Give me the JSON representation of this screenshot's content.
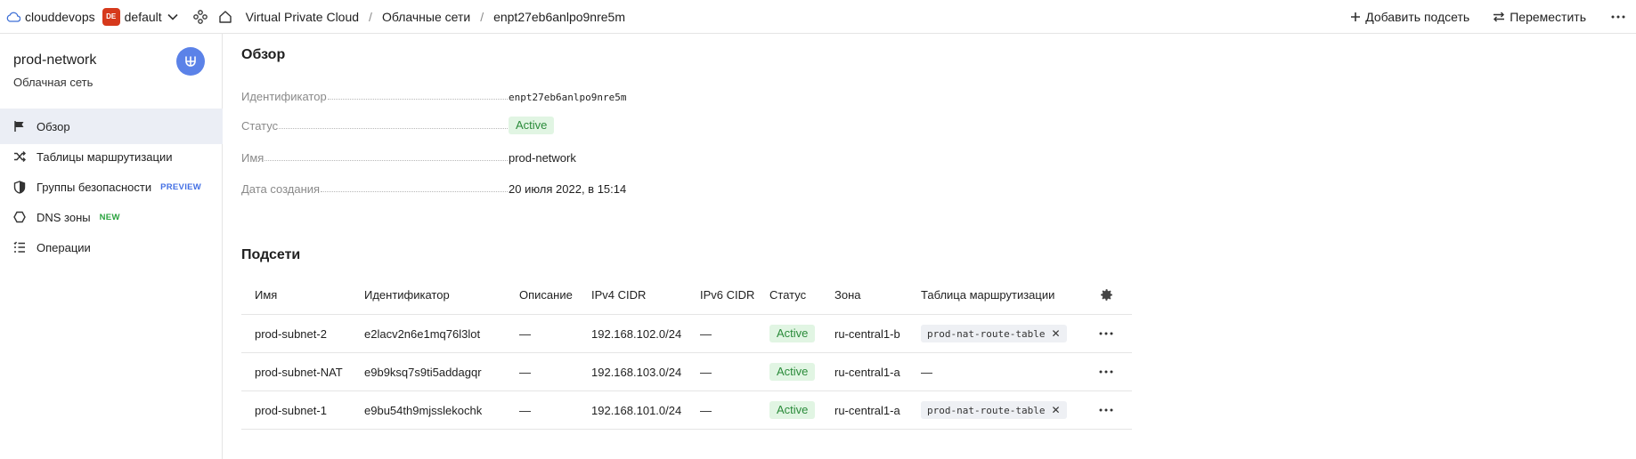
{
  "topbar": {
    "org": "clouddevops",
    "folder_badge": "DE",
    "folder": "default",
    "breadcrumbs": [
      "Virtual Private Cloud",
      "Облачные сети",
      "enpt27eb6anlpo9nre5m"
    ],
    "breadcrumb_separator": "/",
    "actions": {
      "add_subnet": "Добавить подсеть",
      "move": "Переместить"
    }
  },
  "sidebar": {
    "title": "prod-network",
    "subtitle": "Облачная сеть",
    "items": [
      {
        "label": "Обзор",
        "icon": "flag-icon",
        "active": true,
        "tag": ""
      },
      {
        "label": "Таблицы маршрутизации",
        "icon": "shuffle-icon",
        "active": false,
        "tag": ""
      },
      {
        "label": "Группы безопасности",
        "icon": "shield-icon",
        "active": false,
        "tag": "PREVIEW"
      },
      {
        "label": "DNS зоны",
        "icon": "hexagon-icon",
        "active": false,
        "tag": "NEW"
      },
      {
        "label": "Операции",
        "icon": "list-icon",
        "active": false,
        "tag": ""
      }
    ]
  },
  "overview": {
    "heading": "Обзор",
    "properties": [
      {
        "key": "Идентификатор",
        "value": "enpt27eb6anlpo9nre5m"
      },
      {
        "key": "Статус",
        "value": "Active"
      },
      {
        "key": "Имя",
        "value": "prod-network"
      },
      {
        "key": "Дата создания",
        "value": "20 июля 2022, в 15:14"
      }
    ]
  },
  "subnets": {
    "heading": "Подсети",
    "columns": [
      "Имя",
      "Идентификатор",
      "Описание",
      "IPv4 CIDR",
      "IPv6 CIDR",
      "Статус",
      "Зона",
      "Таблица маршрутизации"
    ],
    "rows": [
      {
        "name": "prod-subnet-2",
        "id": "e2lacv2n6e1mq76l3lot",
        "description": "—",
        "ipv4": "192.168.102.0/24",
        "ipv6": "—",
        "status": "Active",
        "zone": "ru-central1-b",
        "route_table": "prod-nat-route-table"
      },
      {
        "name": "prod-subnet-NAT",
        "id": "e9b9ksq7s9ti5addagqr",
        "description": "—",
        "ipv4": "192.168.103.0/24",
        "ipv6": "—",
        "status": "Active",
        "zone": "ru-central1-a",
        "route_table": "—"
      },
      {
        "name": "prod-subnet-1",
        "id": "e9bu54th9mjsslekochk",
        "description": "—",
        "ipv4": "192.168.101.0/24",
        "ipv6": "—",
        "status": "Active",
        "zone": "ru-central1-a",
        "route_table": "prod-nat-route-table"
      }
    ]
  },
  "colors": {
    "accent": "#5b82e8",
    "active_bg": "#e1f5e3",
    "active_text": "#2a8b3a",
    "folder_badge": "#d6391c",
    "preview_tag": "#4470e4",
    "new_tag": "#2aa33e"
  }
}
